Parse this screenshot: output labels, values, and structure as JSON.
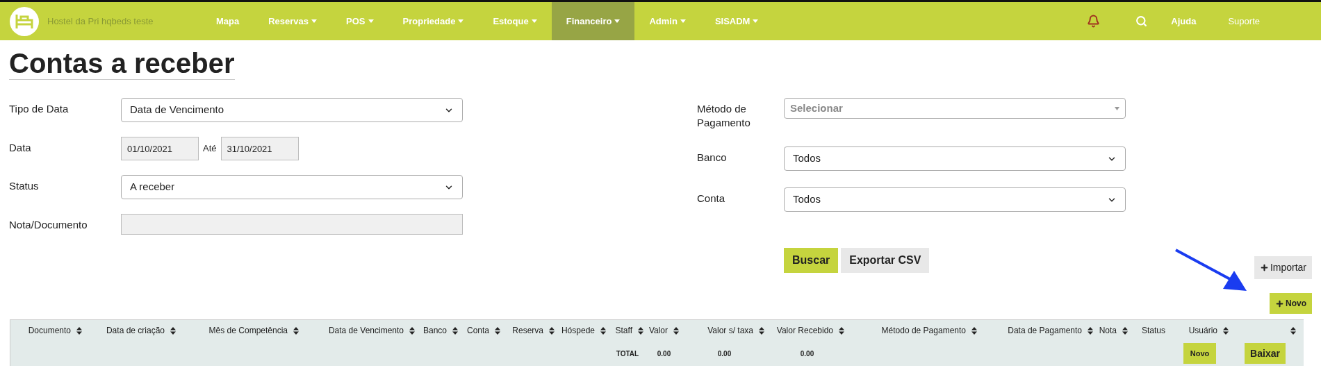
{
  "nav": {
    "brand": "Hostel da Pri hqbeds teste",
    "items": [
      {
        "label": "Mapa",
        "dropdown": false,
        "selected": false
      },
      {
        "label": "Reservas",
        "dropdown": true,
        "selected": false
      },
      {
        "label": "POS",
        "dropdown": true,
        "selected": false
      },
      {
        "label": "Propriedade",
        "dropdown": true,
        "selected": false
      },
      {
        "label": "Estoque",
        "dropdown": true,
        "selected": false
      },
      {
        "label": "Financeiro",
        "dropdown": true,
        "selected": true
      },
      {
        "label": "Admin",
        "dropdown": true,
        "selected": false
      },
      {
        "label": "SISADM",
        "dropdown": true,
        "selected": false
      }
    ],
    "links": [
      "Ajuda",
      "Suporte"
    ]
  },
  "title": "Contas a receber",
  "filters_left": [
    {
      "kind": "select",
      "label": "Tipo de Data",
      "value": "Data de Vencimento"
    },
    {
      "kind": "date_range",
      "label": "Data",
      "from": "01/10/2021",
      "separator": "Até",
      "to": "31/10/2021"
    },
    {
      "kind": "select",
      "label": "Status",
      "value": "A receber"
    },
    {
      "kind": "text",
      "label": "Nota/Documento"
    }
  ],
  "filters_right": [
    {
      "kind": "combo",
      "label": "Método de Pagamento",
      "placeholder": "Selecionar"
    },
    {
      "kind": "select",
      "label": "Banco",
      "value": "Todos"
    },
    {
      "kind": "select",
      "label": "Conta",
      "value": "Todos"
    }
  ],
  "actions": [
    {
      "label": "Buscar",
      "kind": "primary"
    },
    {
      "label": "Exportar CSV",
      "kind": "secondary"
    }
  ],
  "import_button": "Importar",
  "new_button": "Novo",
  "table": {
    "columns": [
      {
        "label": "Documento",
        "sortable": true
      },
      {
        "label": "Data de criação",
        "sortable": true
      },
      {
        "label": "Mês de Competência",
        "sortable": true
      },
      {
        "label": "Data de Vencimento",
        "sortable": true
      },
      {
        "label": "Banco",
        "sortable": true
      },
      {
        "label": "Conta",
        "sortable": true
      },
      {
        "label": "Reserva",
        "sortable": true
      },
      {
        "label": "Hóspede",
        "sortable": true
      },
      {
        "label": "Staff",
        "sortable": true,
        "total": {
          "kind": "text",
          "text": "TOTAL"
        }
      },
      {
        "label": "Valor",
        "sortable": true,
        "total": {
          "kind": "text",
          "text": "0.00"
        }
      },
      {
        "label": "Valor s/ taxa",
        "sortable": true,
        "total": {
          "kind": "text",
          "text": "0.00"
        }
      },
      {
        "label": "Valor Recebido",
        "sortable": true,
        "total": {
          "kind": "text",
          "text": "0.00"
        }
      },
      {
        "label": "Método de Pagamento",
        "sortable": true
      },
      {
        "label": "Data de Pagamento",
        "sortable": true
      },
      {
        "label": "Nota",
        "sortable": true
      },
      {
        "label": "Status",
        "sortable": false
      },
      {
        "label": "Usuário",
        "sortable": true,
        "total": {
          "kind": "button",
          "text": "Novo"
        }
      },
      {
        "sortable": true,
        "total": {
          "kind": "button",
          "text": "Baixar"
        }
      }
    ]
  }
}
